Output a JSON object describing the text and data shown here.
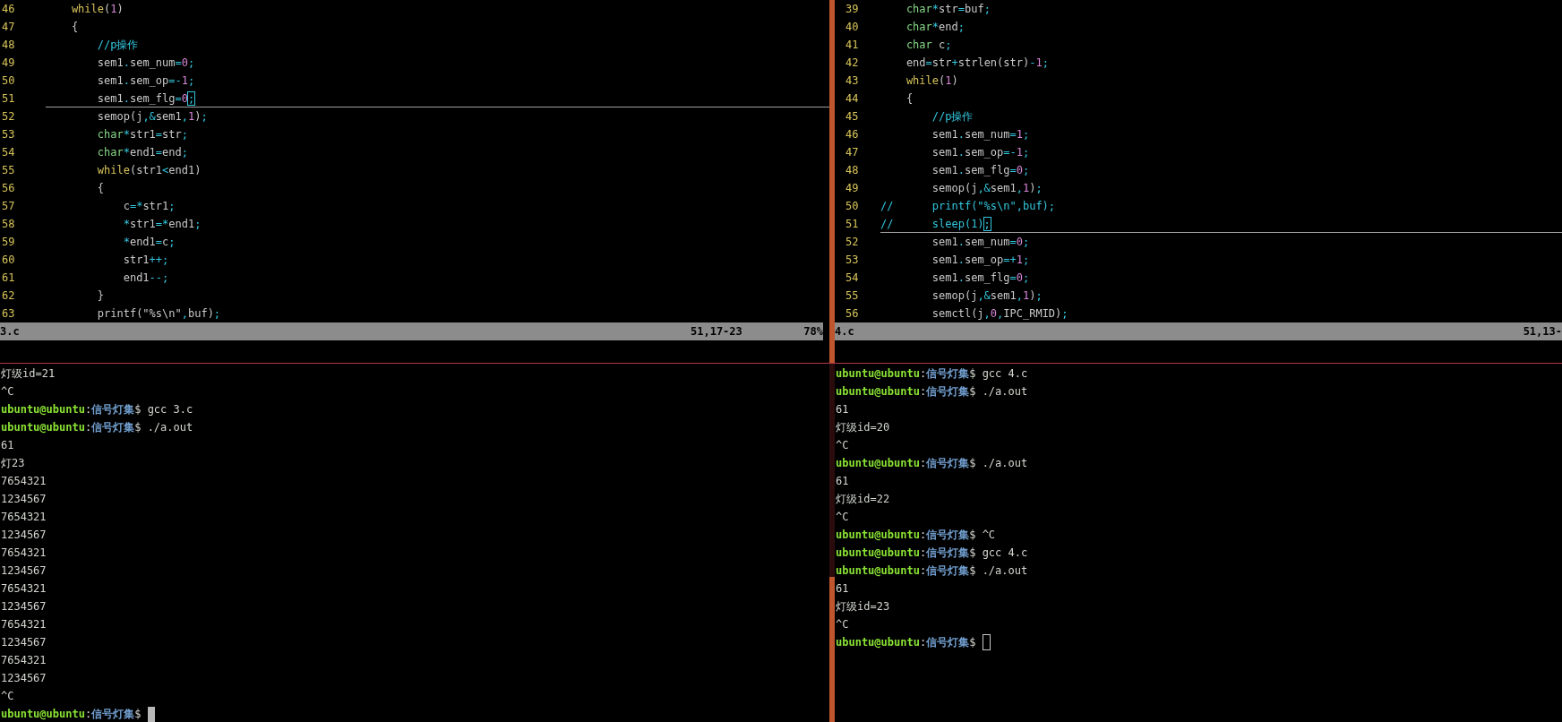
{
  "editors": [
    {
      "lines": [
        {
          "number": "46",
          "current": false,
          "segments": [
            {
              "kind": "keyword",
              "text": "    while"
            },
            {
              "kind": "plain",
              "text": "("
            },
            {
              "kind": "number",
              "text": "1"
            },
            {
              "kind": "plain",
              "text": ")"
            }
          ]
        },
        {
          "number": "47",
          "current": false,
          "segments": [
            {
              "kind": "plain",
              "text": "    {"
            }
          ]
        },
        {
          "number": "48",
          "current": false,
          "segments": [
            {
              "kind": "comment",
              "text": "        //p操作"
            }
          ]
        },
        {
          "number": "49",
          "current": false,
          "segments": [
            {
              "kind": "plain",
              "text": "        sem1"
            },
            {
              "kind": "punct",
              "text": "."
            },
            {
              "kind": "plain",
              "text": "sem_num"
            },
            {
              "kind": "punct",
              "text": "="
            },
            {
              "kind": "number",
              "text": "0"
            },
            {
              "kind": "punct",
              "text": ";"
            }
          ]
        },
        {
          "number": "50",
          "current": false,
          "segments": [
            {
              "kind": "plain",
              "text": "        sem1"
            },
            {
              "kind": "punct",
              "text": "."
            },
            {
              "kind": "plain",
              "text": "sem_op"
            },
            {
              "kind": "punct",
              "text": "=-"
            },
            {
              "kind": "number",
              "text": "1"
            },
            {
              "kind": "punct",
              "text": ";"
            }
          ]
        },
        {
          "number": "51",
          "current": true,
          "segments": [
            {
              "kind": "plain",
              "text": "        sem1"
            },
            {
              "kind": "punct",
              "text": "."
            },
            {
              "kind": "plain",
              "text": "sem_flg"
            },
            {
              "kind": "punct",
              "text": "="
            },
            {
              "kind": "number",
              "text": "0"
            },
            {
              "kind": "punct",
              "text": ";"
            }
          ]
        },
        {
          "number": "52",
          "current": false,
          "segments": [
            {
              "kind": "plain",
              "text": "        semop(j"
            },
            {
              "kind": "punct",
              "text": ",&"
            },
            {
              "kind": "plain",
              "text": "sem1"
            },
            {
              "kind": "punct",
              "text": ","
            },
            {
              "kind": "number",
              "text": "1"
            },
            {
              "kind": "plain",
              "text": ")"
            },
            {
              "kind": "punct",
              "text": ";"
            }
          ]
        },
        {
          "number": "53",
          "current": false,
          "segments": [
            {
              "kind": "type",
              "text": "        char"
            },
            {
              "kind": "punct",
              "text": "*"
            },
            {
              "kind": "plain",
              "text": "str1"
            },
            {
              "kind": "punct",
              "text": "="
            },
            {
              "kind": "plain",
              "text": "str"
            },
            {
              "kind": "punct",
              "text": ";"
            }
          ]
        },
        {
          "number": "54",
          "current": false,
          "segments": [
            {
              "kind": "type",
              "text": "        char"
            },
            {
              "kind": "punct",
              "text": "*"
            },
            {
              "kind": "plain",
              "text": "end1"
            },
            {
              "kind": "punct",
              "text": "="
            },
            {
              "kind": "plain",
              "text": "end"
            },
            {
              "kind": "punct",
              "text": ";"
            }
          ]
        },
        {
          "number": "55",
          "current": false,
          "segments": [
            {
              "kind": "keyword",
              "text": "        while"
            },
            {
              "kind": "plain",
              "text": "(str1"
            },
            {
              "kind": "punct",
              "text": "<"
            },
            {
              "kind": "plain",
              "text": "end1)"
            }
          ]
        },
        {
          "number": "56",
          "current": false,
          "segments": [
            {
              "kind": "plain",
              "text": "        {"
            }
          ]
        },
        {
          "number": "57",
          "current": false,
          "segments": [
            {
              "kind": "plain",
              "text": "            c"
            },
            {
              "kind": "punct",
              "text": "=*"
            },
            {
              "kind": "plain",
              "text": "str1"
            },
            {
              "kind": "punct",
              "text": ";"
            }
          ]
        },
        {
          "number": "58",
          "current": false,
          "segments": [
            {
              "kind": "punct",
              "text": "            *"
            },
            {
              "kind": "plain",
              "text": "str1"
            },
            {
              "kind": "punct",
              "text": "=*"
            },
            {
              "kind": "plain",
              "text": "end1"
            },
            {
              "kind": "punct",
              "text": ";"
            }
          ]
        },
        {
          "number": "59",
          "current": false,
          "segments": [
            {
              "kind": "punct",
              "text": "            *"
            },
            {
              "kind": "plain",
              "text": "end1"
            },
            {
              "kind": "punct",
              "text": "="
            },
            {
              "kind": "plain",
              "text": "c"
            },
            {
              "kind": "punct",
              "text": ";"
            }
          ]
        },
        {
          "number": "60",
          "current": false,
          "segments": [
            {
              "kind": "plain",
              "text": "            str1"
            },
            {
              "kind": "punct",
              "text": "++;"
            }
          ]
        },
        {
          "number": "61",
          "current": false,
          "segments": [
            {
              "kind": "plain",
              "text": "            end1"
            },
            {
              "kind": "punct",
              "text": "--;"
            }
          ]
        },
        {
          "number": "62",
          "current": false,
          "segments": [
            {
              "kind": "plain",
              "text": "        }"
            }
          ]
        },
        {
          "number": "63",
          "current": false,
          "segments": [
            {
              "kind": "plain",
              "text": "        printf(\"%s\\n\""
            },
            {
              "kind": "punct",
              "text": ","
            },
            {
              "kind": "plain",
              "text": "buf)"
            },
            {
              "kind": "punct",
              "text": ";"
            }
          ]
        }
      ],
      "status_bar": {
        "file": "3.c",
        "position": "51,17-23",
        "scroll": "78%"
      }
    },
    {
      "lines": [
        {
          "number": "39",
          "current": false,
          "segments": [
            {
              "kind": "type",
              "text": "    char"
            },
            {
              "kind": "punct",
              "text": "*"
            },
            {
              "kind": "plain",
              "text": "str"
            },
            {
              "kind": "punct",
              "text": "="
            },
            {
              "kind": "plain",
              "text": "buf"
            },
            {
              "kind": "punct",
              "text": ";"
            }
          ]
        },
        {
          "number": "40",
          "current": false,
          "segments": [
            {
              "kind": "type",
              "text": "    char"
            },
            {
              "kind": "punct",
              "text": "*"
            },
            {
              "kind": "plain",
              "text": "end"
            },
            {
              "kind": "punct",
              "text": ";"
            }
          ]
        },
        {
          "number": "41",
          "current": false,
          "segments": [
            {
              "kind": "type",
              "text": "    char"
            },
            {
              "kind": "plain",
              "text": " c"
            },
            {
              "kind": "punct",
              "text": ";"
            }
          ]
        },
        {
          "number": "42",
          "current": false,
          "segments": [
            {
              "kind": "plain",
              "text": "    end"
            },
            {
              "kind": "punct",
              "text": "="
            },
            {
              "kind": "plain",
              "text": "str"
            },
            {
              "kind": "punct",
              "text": "+"
            },
            {
              "kind": "plain",
              "text": "strlen(str)"
            },
            {
              "kind": "punct",
              "text": "-"
            },
            {
              "kind": "number",
              "text": "1"
            },
            {
              "kind": "punct",
              "text": ";"
            }
          ]
        },
        {
          "number": "43",
          "current": false,
          "segments": [
            {
              "kind": "keyword",
              "text": "    while"
            },
            {
              "kind": "plain",
              "text": "("
            },
            {
              "kind": "number",
              "text": "1"
            },
            {
              "kind": "plain",
              "text": ")"
            }
          ]
        },
        {
          "number": "44",
          "current": false,
          "segments": [
            {
              "kind": "plain",
              "text": "    {"
            }
          ]
        },
        {
          "number": "45",
          "current": false,
          "segments": [
            {
              "kind": "comment",
              "text": "        //p操作"
            }
          ]
        },
        {
          "number": "46",
          "current": false,
          "segments": [
            {
              "kind": "plain",
              "text": "        sem1"
            },
            {
              "kind": "punct",
              "text": "."
            },
            {
              "kind": "plain",
              "text": "sem_num"
            },
            {
              "kind": "punct",
              "text": "="
            },
            {
              "kind": "number",
              "text": "1"
            },
            {
              "kind": "punct",
              "text": ";"
            }
          ]
        },
        {
          "number": "47",
          "current": false,
          "segments": [
            {
              "kind": "plain",
              "text": "        sem1"
            },
            {
              "kind": "punct",
              "text": "."
            },
            {
              "kind": "plain",
              "text": "sem_op"
            },
            {
              "kind": "punct",
              "text": "=-"
            },
            {
              "kind": "number",
              "text": "1"
            },
            {
              "kind": "punct",
              "text": ";"
            }
          ]
        },
        {
          "number": "48",
          "current": false,
          "segments": [
            {
              "kind": "plain",
              "text": "        sem1"
            },
            {
              "kind": "punct",
              "text": "."
            },
            {
              "kind": "plain",
              "text": "sem_flg"
            },
            {
              "kind": "punct",
              "text": "="
            },
            {
              "kind": "number",
              "text": "0"
            },
            {
              "kind": "punct",
              "text": ";"
            }
          ]
        },
        {
          "number": "49",
          "current": false,
          "segments": [
            {
              "kind": "plain",
              "text": "        semop(j"
            },
            {
              "kind": "punct",
              "text": ",&"
            },
            {
              "kind": "plain",
              "text": "sem1"
            },
            {
              "kind": "punct",
              "text": ","
            },
            {
              "kind": "number",
              "text": "1"
            },
            {
              "kind": "plain",
              "text": ")"
            },
            {
              "kind": "punct",
              "text": ";"
            }
          ]
        },
        {
          "number": "50",
          "current": false,
          "segments": [
            {
              "kind": "comment",
              "text": "//      printf(\"%s\\n\",buf);"
            }
          ]
        },
        {
          "number": "51",
          "current": true,
          "segments": [
            {
              "kind": "comment",
              "text": "//      sleep(1)"
            },
            {
              "kind": "comment",
              "text": ";"
            }
          ]
        },
        {
          "number": "52",
          "current": false,
          "segments": [
            {
              "kind": "plain",
              "text": "        sem1"
            },
            {
              "kind": "punct",
              "text": "."
            },
            {
              "kind": "plain",
              "text": "sem_num"
            },
            {
              "kind": "punct",
              "text": "="
            },
            {
              "kind": "number",
              "text": "0"
            },
            {
              "kind": "punct",
              "text": ";"
            }
          ]
        },
        {
          "number": "53",
          "current": false,
          "segments": [
            {
              "kind": "plain",
              "text": "        sem1"
            },
            {
              "kind": "punct",
              "text": "."
            },
            {
              "kind": "plain",
              "text": "sem_op"
            },
            {
              "kind": "punct",
              "text": "=+"
            },
            {
              "kind": "number",
              "text": "1"
            },
            {
              "kind": "punct",
              "text": ";"
            }
          ]
        },
        {
          "number": "54",
          "current": false,
          "segments": [
            {
              "kind": "plain",
              "text": "        sem1"
            },
            {
              "kind": "punct",
              "text": "."
            },
            {
              "kind": "plain",
              "text": "sem_flg"
            },
            {
              "kind": "punct",
              "text": "="
            },
            {
              "kind": "number",
              "text": "0"
            },
            {
              "kind": "punct",
              "text": ";"
            }
          ]
        },
        {
          "number": "55",
          "current": false,
          "segments": [
            {
              "kind": "plain",
              "text": "        semop(j"
            },
            {
              "kind": "punct",
              "text": ",&"
            },
            {
              "kind": "plain",
              "text": "sem1"
            },
            {
              "kind": "punct",
              "text": ","
            },
            {
              "kind": "number",
              "text": "1"
            },
            {
              "kind": "plain",
              "text": ")"
            },
            {
              "kind": "punct",
              "text": ";"
            }
          ]
        },
        {
          "number": "56",
          "current": false,
          "segments": [
            {
              "kind": "plain",
              "text": "        semctl(j"
            },
            {
              "kind": "punct",
              "text": ","
            },
            {
              "kind": "number",
              "text": "0"
            },
            {
              "kind": "punct",
              "text": ","
            },
            {
              "kind": "plain",
              "text": "IPC_RMID)"
            },
            {
              "kind": "punct",
              "text": ";"
            }
          ]
        }
      ],
      "status_bar": {
        "file": "4.c",
        "position": "51,13-"
      }
    }
  ],
  "terminals": [
    {
      "cursor_focused": true,
      "lines": [
        {
          "kind": "output",
          "text": "灯级id=21"
        },
        {
          "kind": "output",
          "text": "^C"
        },
        {
          "kind": "prompt",
          "user": "ubuntu@ubuntu",
          "separator": ":",
          "path": "信号灯集",
          "symbol": "$",
          "command": "gcc 3.c"
        },
        {
          "kind": "prompt",
          "user": "ubuntu@ubuntu",
          "separator": ":",
          "path": "信号灯集",
          "symbol": "$",
          "command": "./a.out"
        },
        {
          "kind": "output",
          "text": "61"
        },
        {
          "kind": "output",
          "text": "灯23"
        },
        {
          "kind": "output",
          "text": "7654321"
        },
        {
          "kind": "output",
          "text": "1234567"
        },
        {
          "kind": "output",
          "text": "7654321"
        },
        {
          "kind": "output",
          "text": "1234567"
        },
        {
          "kind": "output",
          "text": "7654321"
        },
        {
          "kind": "output",
          "text": "1234567"
        },
        {
          "kind": "output",
          "text": "7654321"
        },
        {
          "kind": "output",
          "text": "1234567"
        },
        {
          "kind": "output",
          "text": "7654321"
        },
        {
          "kind": "output",
          "text": "1234567"
        },
        {
          "kind": "output",
          "text": "7654321"
        },
        {
          "kind": "output",
          "text": "1234567"
        },
        {
          "kind": "output",
          "text": "^C"
        },
        {
          "kind": "prompt",
          "user": "ubuntu@ubuntu",
          "separator": ":",
          "path": "信号灯集",
          "symbol": "$"
        }
      ]
    },
    {
      "cursor_focused": false,
      "lines": [
        {
          "kind": "prompt",
          "user": "ubuntu@ubuntu",
          "separator": ":",
          "path": "信号灯集",
          "symbol": "$",
          "command": "gcc 4.c"
        },
        {
          "kind": "prompt",
          "user": "ubuntu@ubuntu",
          "separator": ":",
          "path": "信号灯集",
          "symbol": "$",
          "command": "./a.out"
        },
        {
          "kind": "output",
          "text": "61"
        },
        {
          "kind": "output",
          "text": "灯级id=20"
        },
        {
          "kind": "output",
          "text": "^C"
        },
        {
          "kind": "prompt",
          "user": "ubuntu@ubuntu",
          "separator": ":",
          "path": "信号灯集",
          "symbol": "$",
          "command": "./a.out"
        },
        {
          "kind": "output",
          "text": "61"
        },
        {
          "kind": "output",
          "text": "灯级id=22"
        },
        {
          "kind": "output",
          "text": "^C"
        },
        {
          "kind": "prompt",
          "user": "ubuntu@ubuntu",
          "separator": ":",
          "path": "信号灯集",
          "symbol": "$",
          "command": "^C"
        },
        {
          "kind": "prompt",
          "user": "ubuntu@ubuntu",
          "separator": ":",
          "path": "信号灯集",
          "symbol": "$",
          "command": "gcc 4.c"
        },
        {
          "kind": "prompt",
          "user": "ubuntu@ubuntu",
          "separator": ":",
          "path": "信号灯集",
          "symbol": "$",
          "command": "./a.out"
        },
        {
          "kind": "output",
          "text": "61"
        },
        {
          "kind": "output",
          "text": "灯级id=23"
        },
        {
          "kind": "output",
          "text": "^C"
        },
        {
          "kind": "prompt",
          "user": "ubuntu@ubuntu",
          "separator": ":",
          "path": "信号灯集",
          "symbol": "$"
        }
      ]
    }
  ]
}
